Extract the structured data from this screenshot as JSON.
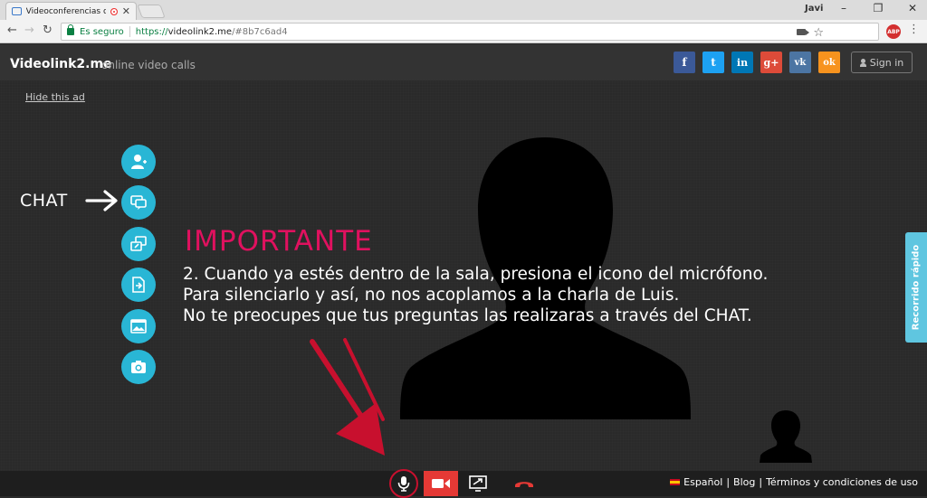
{
  "browser": {
    "tab_title": "Videoconferencias on",
    "user_label": "Javi",
    "secure_label": "Es seguro",
    "url_proto": "https://",
    "url_host": "videolink2.me",
    "url_rest": "/#8b7c6ad4",
    "extension_badge": "ABP"
  },
  "header": {
    "brand": "Videolink2.me",
    "tagline": "online video calls",
    "social": [
      {
        "letter": "f",
        "color": "#3b5998"
      },
      {
        "letter": "t",
        "color": "#1da1f2"
      },
      {
        "letter": "in",
        "color": "#0077b5"
      },
      {
        "letter": "g+",
        "color": "#dd4b39"
      },
      {
        "letter": "vk",
        "color": "#4c75a3"
      },
      {
        "letter": "ok",
        "color": "#f7931e"
      }
    ],
    "signin_label": "Sign in"
  },
  "stage": {
    "hide_ad": "Hide this ad",
    "chat_label": "CHAT",
    "important": "IMPORTANTE",
    "message_lines": [
      "2. Cuando ya estés dentro de la sala, presiona el icono del micrófono.",
      "Para silenciarlo y así, no nos acoplamos a la charla de Luis.",
      "No te preocupes que tus preguntas las realizaras a través del CHAT."
    ],
    "rapido_label": "Recorrido rápido"
  },
  "footer": {
    "language": "Español",
    "blog": "Blog",
    "terms": "Términos y condiciones de uso",
    "divider": "|"
  },
  "colors": {
    "accent": "#29b6d5",
    "important": "#e0115f",
    "camera_btn": "#e53935"
  }
}
